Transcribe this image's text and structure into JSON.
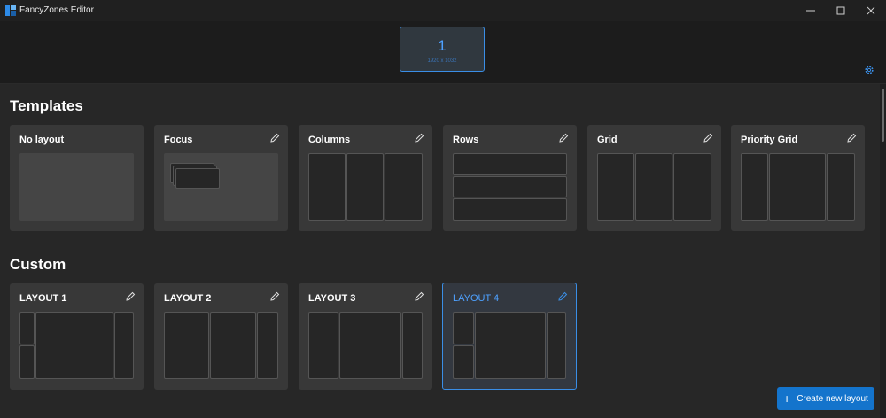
{
  "window": {
    "title": "FancyZones Editor",
    "minimize": "—",
    "maximize": "☐",
    "close": "✕"
  },
  "monitor": {
    "number": "1",
    "resolution": "1920 x 1032"
  },
  "sections": {
    "templates": "Templates",
    "custom": "Custom"
  },
  "templates": [
    "No layout",
    "Focus",
    "Columns",
    "Rows",
    "Grid",
    "Priority Grid"
  ],
  "custom": [
    "LAYOUT 1",
    "LAYOUT 2",
    "LAYOUT 3",
    "LAYOUT 4"
  ],
  "selected_layout": "LAYOUT 4",
  "create_button": {
    "label": "Create new layout",
    "icon": "plus-icon"
  },
  "colors": {
    "accent": "#3a8ee6",
    "button": "#1474cc",
    "card": "#383838",
    "background": "#272727"
  },
  "icons": {
    "edit": "pencil-icon",
    "settings": "gear-icon",
    "app": "fancyzones-icon"
  }
}
